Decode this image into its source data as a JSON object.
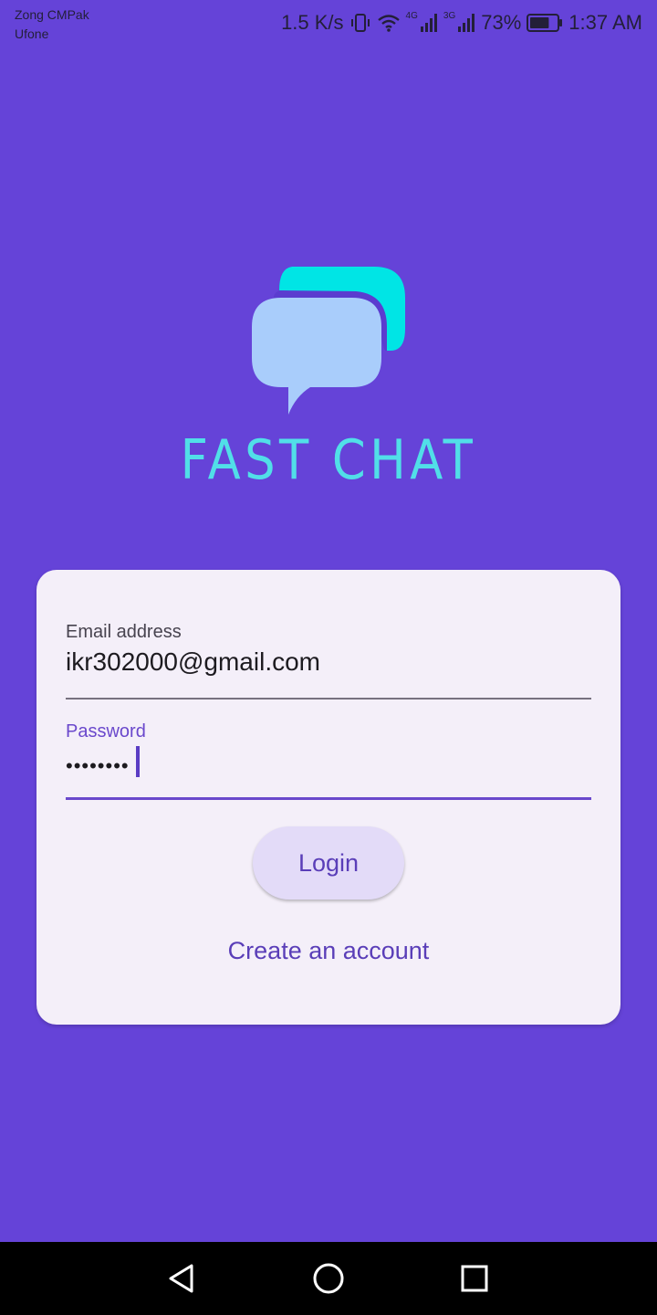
{
  "status_bar": {
    "carrier_1": "Zong CMPak",
    "carrier_2": "Ufone",
    "network_speed": "1.5 K/s",
    "network_tag_1": "4G",
    "network_tag_2": "3G",
    "battery_percent": "73%",
    "battery_level": 0.73,
    "time": "1:37 AM",
    "icons": [
      "vibrate-icon",
      "wifi-icon",
      "signal-4g-icon",
      "signal-3g-icon",
      "battery-icon"
    ]
  },
  "logo": {
    "icon": "chat-bubbles-icon",
    "colors": {
      "back_bubble": "#00e5e5",
      "front_bubble": "#a9cdfb"
    }
  },
  "app_title": "FAST CHAT",
  "login_form": {
    "email": {
      "label": "Email address",
      "value": "ikr302000@gmail.com"
    },
    "password": {
      "label": "Password",
      "value": "••••••••"
    },
    "login_button": "Login",
    "create_account_link": "Create an account"
  },
  "nav_bar": {
    "icons": [
      "back-icon",
      "home-icon",
      "recents-icon"
    ]
  },
  "colors": {
    "background": "#6543d8",
    "accent": "#6a48cc",
    "card": "#f4eff9",
    "title": "#51dfe8"
  }
}
